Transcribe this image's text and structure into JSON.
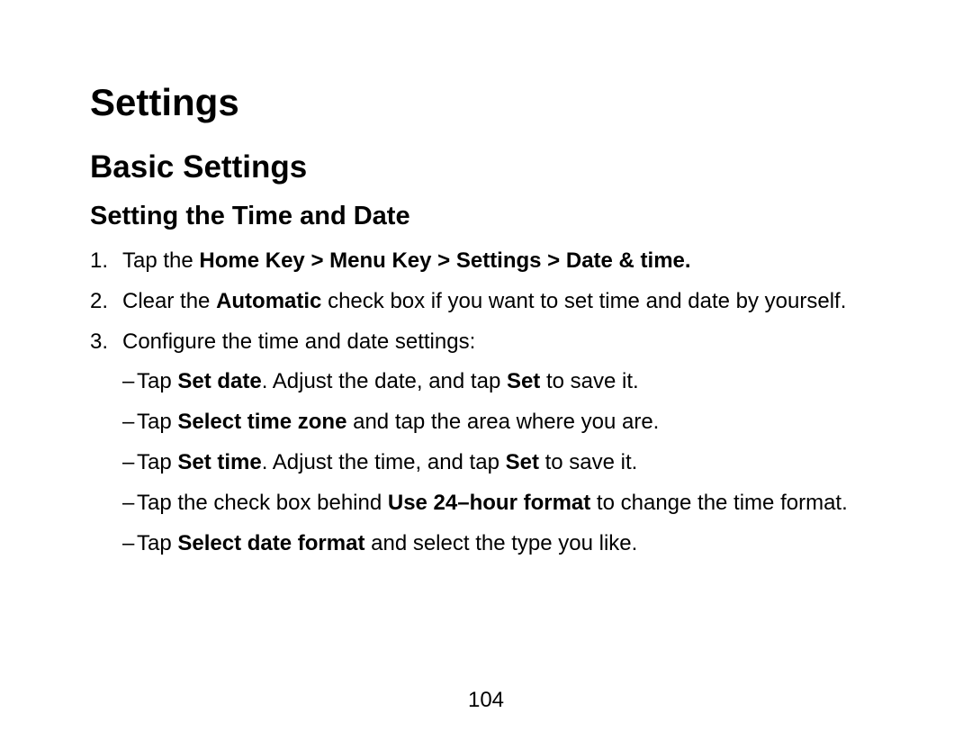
{
  "heading1": "Settings",
  "heading2": "Basic Settings",
  "heading3": "Setting the Time and Date",
  "steps": {
    "s1": {
      "prefix": "Tap the ",
      "bold": "Home Key > Menu Key > Settings > Date & time."
    },
    "s2": {
      "p1": "Clear the ",
      "b1": "Automatic",
      "p2": " check box if you want to set time and date by yourself."
    },
    "s3": {
      "intro": "Configure the time and date settings:",
      "sub1": {
        "p1": "Tap ",
        "b1": "Set date",
        "p2": ". Adjust the date, and tap ",
        "b2": "Set",
        "p3": " to save it."
      },
      "sub2": {
        "p1": "Tap ",
        "b1": "Select time zone",
        "p2": " and tap the area where you are."
      },
      "sub3": {
        "p1": "Tap ",
        "b1": "Set time",
        "p2": ". Adjust the time, and tap ",
        "b2": "Set",
        "p3": " to save it."
      },
      "sub4": {
        "p1": "Tap the check box behind ",
        "b1": "Use 24–hour format",
        "p2": " to change the time format."
      },
      "sub5": {
        "p1": "Tap ",
        "b1": "Select date format",
        "p2": " and select the type you like."
      }
    }
  },
  "pageNumber": "104"
}
